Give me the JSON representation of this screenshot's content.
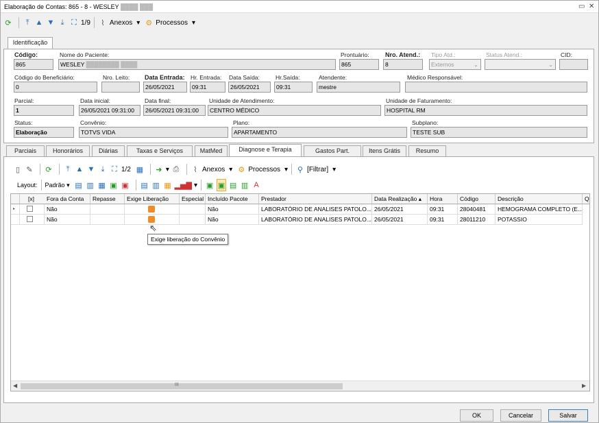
{
  "window": {
    "title": "Elaboração de Contas: 865 - 8 - WESLEY",
    "title_redacted": "████ ███"
  },
  "main_toolbar": {
    "nav_count": "1/9",
    "anexos": "Anexos",
    "processos": "Processos"
  },
  "tabs_top": {
    "identificacao": "Identificação"
  },
  "form": {
    "codigo_label": "Código:",
    "codigo": "865",
    "nome_label": "Nome do Paciente:",
    "nome": "WESLEY",
    "nome_redacted": "████████ ████",
    "prontuario_label": "Prontuário:",
    "prontuario": "865",
    "nro_atend_label": "Nro. Atend.:",
    "nro_atend": "8",
    "tipo_atd_label": "Tipo Atd.:",
    "tipo_atd": "Externos",
    "status_atend_label": "Status Atend.:",
    "status_atend": "",
    "cid_label": "CID:",
    "cid": "",
    "cod_benef_label": "Código do Beneficiário:",
    "cod_benef": "0",
    "nro_leito_label": "Nro. Leito:",
    "nro_leito": "",
    "data_entrada_label": "Data Entrada:",
    "data_entrada": "26/05/2021",
    "hr_entrada_label": "Hr. Entrada:",
    "hr_entrada": "09:31",
    "data_saida_label": "Data Saída:",
    "data_saida": "26/05/2021",
    "hr_saida_label": "Hr.Saída:",
    "hr_saida": "09:31",
    "atendente_label": "Atendente:",
    "atendente": "mestre",
    "medico_label": "Médico Responsável:",
    "medico": "",
    "parcial_label": "Parcial:",
    "parcial": "1",
    "data_inicial_label": "Data inicial:",
    "data_inicial": "26/05/2021 09:31:00",
    "data_final_label": "Data final:",
    "data_final": "26/05/2021 09:31:00",
    "unid_atend_label": "Unidade de Atendimento:",
    "unid_atend": "CENTRO MÉDICO",
    "unid_fat_label": "Unidade de Faturamento:",
    "unid_fat": "HOSPITAL RM",
    "status_label": "Status:",
    "status": "Elaboração",
    "convenio_label": "Convênio:",
    "convenio": "TOTVS VIDA",
    "plano_label": "Plano:",
    "plano": "APARTAMENTO",
    "subplano_label": "Subplano:",
    "subplano": "TESTE SUB"
  },
  "tabs": [
    "Parciais",
    "Honorários",
    "Diárias",
    "Taxas e Serviços",
    "MatMed",
    "Diagnose e Terapia",
    "Gastos Part.",
    "Itens Grátis",
    "Resumo"
  ],
  "inner_toolbar": {
    "nav_count": "1/2",
    "anexos": "Anexos",
    "processos": "Processos",
    "filtrar": "[Filtrar]"
  },
  "layout_bar": {
    "layout": "Layout:",
    "padrao": "Padrão"
  },
  "grid": {
    "columns": [
      "[x]",
      "Fora da Conta",
      "Repasse",
      "Exige Liberação",
      "Especial",
      "Incluído Pacote",
      "Prestador",
      "Data Realização",
      "Hora",
      "Código",
      "Descrição",
      "Q"
    ],
    "rows": [
      {
        "fora": "Não",
        "pacote": "Não",
        "prestador": "LABORATÓRIO DE ANALISES PATOLO...",
        "data": "26/05/2021",
        "hora": "09:31",
        "codigo": "28040481",
        "descricao": "HEMOGRAMA COMPLETO (E..."
      },
      {
        "fora": "Não",
        "pacote": "Não",
        "prestador": "LABORATÓRIO DE ANALISES PATOLO...",
        "data": "26/05/2021",
        "hora": "09:31",
        "codigo": "28011210",
        "descricao": "POTASSIO"
      }
    ],
    "tooltip": "Exige liberação do Convênio",
    "scroll_mid": "III"
  },
  "buttons": {
    "ok": "OK",
    "cancelar": "Cancelar",
    "salvar": "Salvar"
  },
  "colors": {
    "accent": "#2a6fb5",
    "orange_flag": "#f08c2b"
  }
}
